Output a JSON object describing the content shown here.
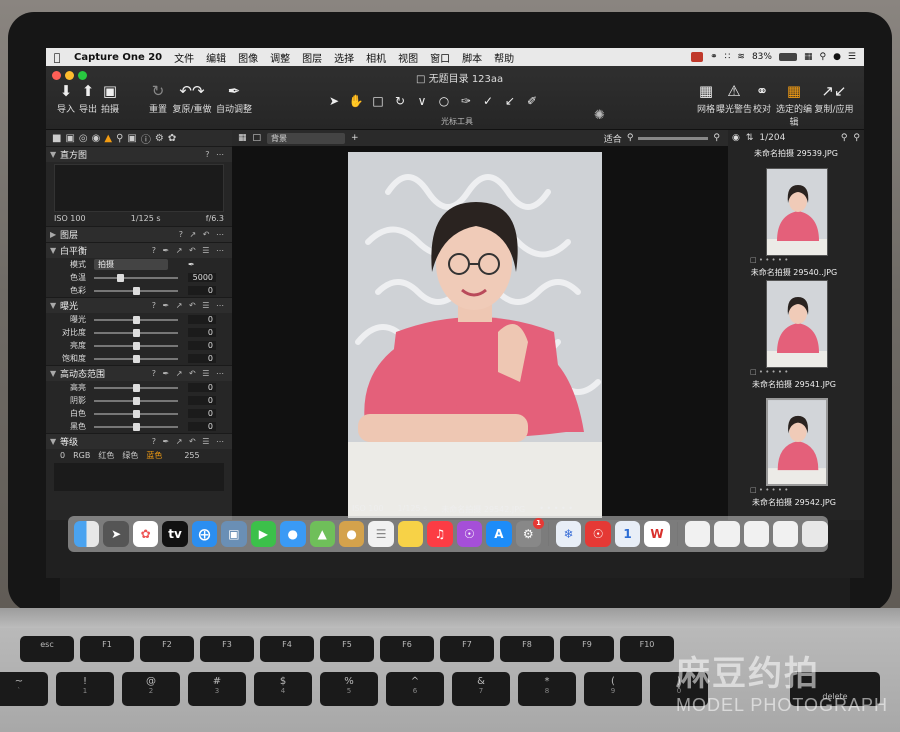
{
  "menubar": {
    "app": "Capture One 20",
    "items": [
      "文件",
      "编辑",
      "图像",
      "调整",
      "图层",
      "选择",
      "相机",
      "视图",
      "窗口",
      "脚本",
      "帮助"
    ],
    "battery": "83%"
  },
  "window": {
    "title": "无题目录 123aa",
    "cursor_tools_label": "光标工具"
  },
  "toolbar_left": [
    {
      "label": "导入",
      "icon": "import-icon"
    },
    {
      "label": "导出",
      "icon": "export-icon"
    },
    {
      "label": "拍摄",
      "icon": "camera-icon"
    },
    {
      "label": "重置",
      "icon": "reset-icon"
    },
    {
      "label": "复原/重做",
      "icon": "undo-redo-icon"
    },
    {
      "label": "自动调整",
      "icon": "auto-adjust-icon"
    }
  ],
  "toolbar_right": [
    {
      "label": "网格",
      "icon": "grid-icon"
    },
    {
      "label": "曝光警告",
      "icon": "warning-icon"
    },
    {
      "label": "校对",
      "icon": "glasses-icon"
    },
    {
      "label": "选定的编辑",
      "icon": "layers-icon"
    },
    {
      "label": "复制/应用",
      "icon": "copy-apply-icon"
    }
  ],
  "histogram": {
    "title": "直方图",
    "iso": "ISO 100",
    "shutter": "1/125 s",
    "aperture": "f/6.3"
  },
  "layers": {
    "title": "图层"
  },
  "white_balance": {
    "title": "白平衡",
    "mode_label": "模式",
    "mode_value": "拍摄",
    "sliders": [
      {
        "label": "色温",
        "value": "5000",
        "pos": 0.3
      },
      {
        "label": "色彩",
        "value": "0",
        "pos": 0.5
      }
    ]
  },
  "exposure": {
    "title": "曝光",
    "sliders": [
      {
        "label": "曝光",
        "value": "0",
        "pos": 0.5
      },
      {
        "label": "对比度",
        "value": "0",
        "pos": 0.5
      },
      {
        "label": "亮度",
        "value": "0",
        "pos": 0.5
      },
      {
        "label": "饱和度",
        "value": "0",
        "pos": 0.5
      }
    ]
  },
  "hdr": {
    "title": "高动态范围",
    "sliders": [
      {
        "label": "高亮",
        "value": "0",
        "pos": 0.5
      },
      {
        "label": "阴影",
        "value": "0",
        "pos": 0.5
      },
      {
        "label": "白色",
        "value": "0",
        "pos": 0.5
      },
      {
        "label": "黑色",
        "value": "0",
        "pos": 0.5
      }
    ]
  },
  "levels": {
    "title": "等级",
    "min": "0",
    "max": "255",
    "channels": [
      "RGB",
      "红色",
      "绿色",
      "蓝色"
    ]
  },
  "viewer": {
    "background": "背景",
    "fit": "适合",
    "iso": "ISO 100",
    "shutter": "1/125 s",
    "filename": "未命名拍摄 29542.JPG"
  },
  "browser": {
    "count": "1/204",
    "top_name": "未命名拍摄 29539.JPG",
    "thumbs": [
      {
        "name": "未命名拍摄 29540..JPG"
      },
      {
        "name": "未命名拍摄 29541.JPG"
      },
      {
        "name": "未命名拍摄 29542.JPG"
      }
    ]
  },
  "keyboard": {
    "esc": "esc",
    "fkeys": [
      "F1",
      "F2",
      "F3",
      "F4",
      "F5",
      "F6",
      "F7",
      "F8",
      "F9",
      "F10"
    ],
    "row2": [
      "~",
      "!",
      "@",
      "#",
      "$",
      "%",
      "^",
      "&",
      "*",
      "(",
      ")"
    ],
    "row2_sub": [
      "`",
      "1",
      "2",
      "3",
      "4",
      "5",
      "6",
      "7",
      "8",
      "9",
      "0"
    ],
    "delete": "delete"
  },
  "watermark": {
    "line1": "麻豆约拍",
    "line2": "MODEL PHOTOGRAPH"
  },
  "dock": {
    "badge": "1"
  },
  "colors": {
    "accent": "#f39c12",
    "shirt": "#e4607a",
    "backdrop": "#c9ccd0"
  }
}
